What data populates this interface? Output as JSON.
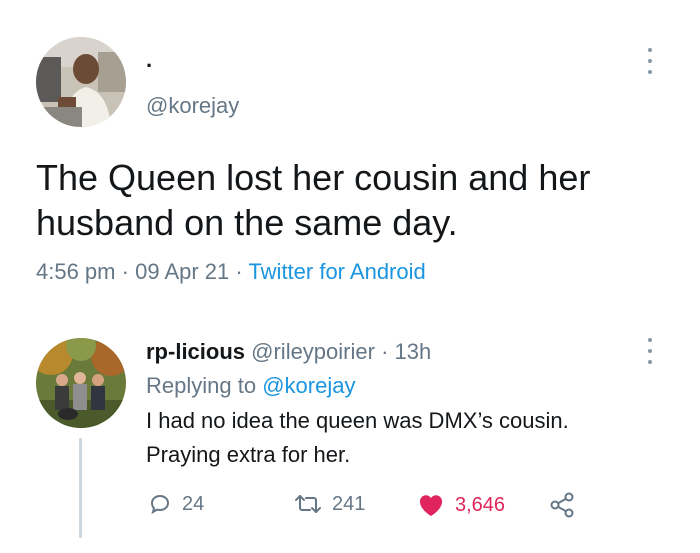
{
  "tweet": {
    "display_name": ".",
    "handle": "@korejay",
    "text_line1": "The Queen lost her cousin and her",
    "text_line2": "husband on the same day.",
    "time": "4:56 pm",
    "sep1": "·",
    "date": "09 Apr 21",
    "sep2": "·",
    "source": "Twitter for Android"
  },
  "reply": {
    "display_name": "rp-licious",
    "handle": "@rileypoirier",
    "sep": "·",
    "age": "13h",
    "replying_to_label": "Replying to",
    "replying_to_handle": "@korejay",
    "text_line1": "I had no idea the queen was DMX’s cousin.",
    "text_line2": "Praying extra for her.",
    "actions": {
      "replies": "24",
      "retweets": "241",
      "likes": "3,646"
    }
  },
  "icons": [
    "more-icon",
    "reply-icon",
    "retweet-icon",
    "heart-icon",
    "share-icon"
  ],
  "colors": {
    "text": "#14171a",
    "muted": "#657786",
    "link": "#1b95e0",
    "like": "#e0245e"
  }
}
